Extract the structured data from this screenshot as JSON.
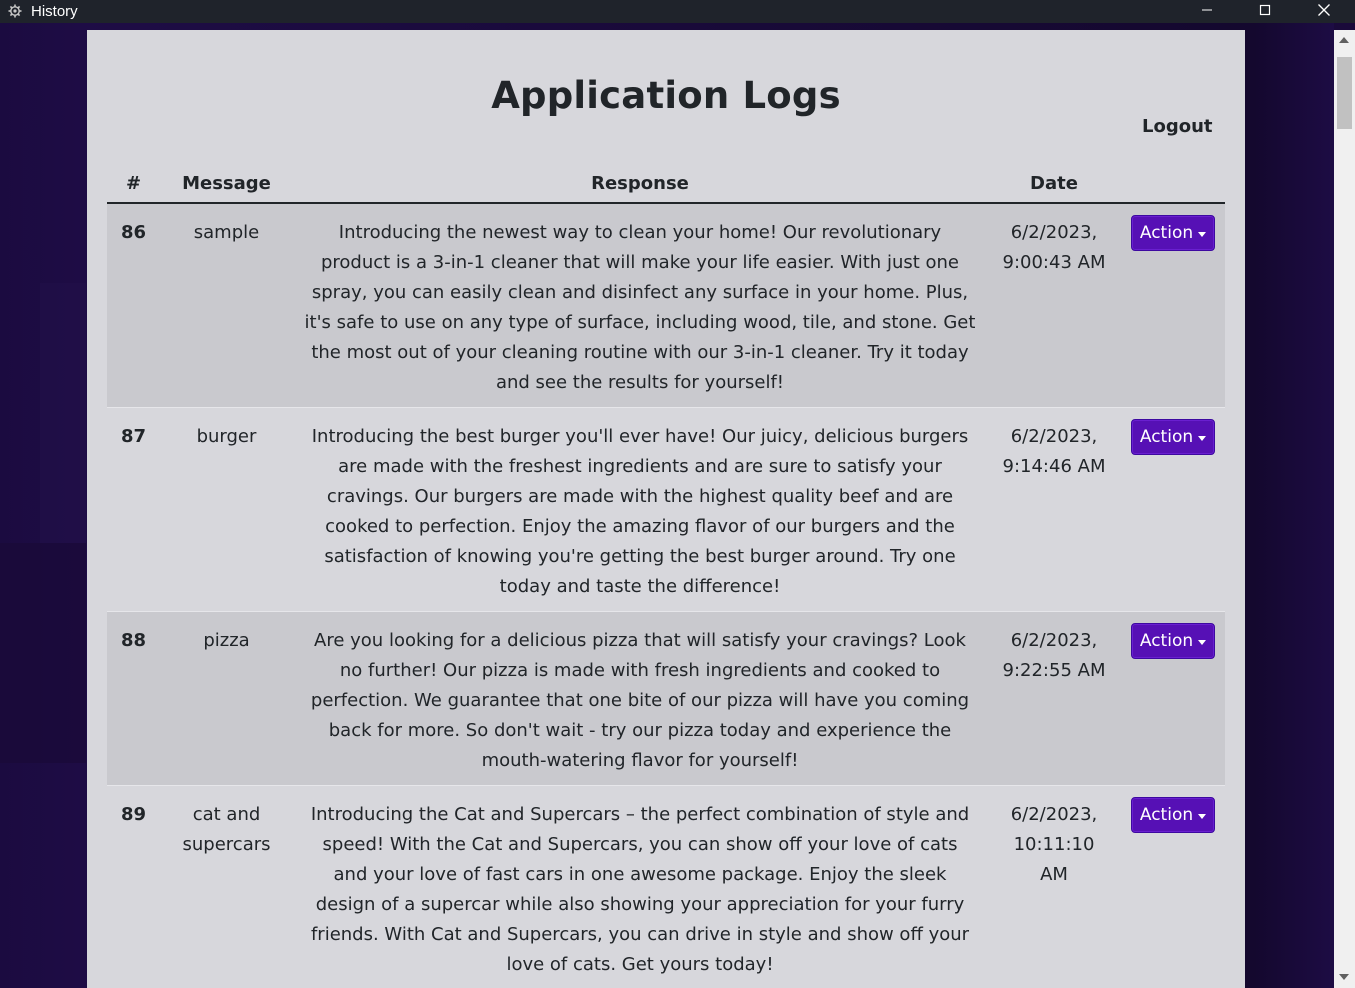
{
  "window": {
    "title": "History",
    "app_icon": "gear-icon",
    "controls": {
      "minimize": "minimize-icon",
      "maximize": "maximize-icon",
      "close": "close-icon"
    }
  },
  "page": {
    "title": "Application Logs",
    "logout_label": "Logout"
  },
  "table": {
    "headers": {
      "num": "#",
      "message": "Message",
      "response": "Response",
      "date": "Date"
    },
    "rows": [
      {
        "id": "86",
        "message": "sample",
        "response": "Introducing the newest way to clean your home! Our revolutionary product is a 3-in-1 cleaner that will make your life easier. With just one spray, you can easily clean and disinfect any surface in your home. Plus, it's safe to use on any type of surface, including wood, tile, and stone. Get the most out of your cleaning routine with our 3-in-1 cleaner. Try it today and see the results for yourself!",
        "date": "6/2/2023, 9:00:43 AM",
        "action_label": "Action"
      },
      {
        "id": "87",
        "message": "burger",
        "response": "Introducing the best burger you'll ever have! Our juicy, delicious burgers are made with the freshest ingredients and are sure to satisfy your cravings. Our burgers are made with the highest quality beef and are cooked to perfection. Enjoy the amazing flavor of our burgers and the satisfaction of knowing you're getting the best burger around. Try one today and taste the difference!",
        "date": "6/2/2023, 9:14:46 AM",
        "action_label": "Action"
      },
      {
        "id": "88",
        "message": "pizza",
        "response": "Are you looking for a delicious pizza that will satisfy your cravings? Look no further! Our pizza is made with fresh ingredients and cooked to perfection. We guarantee that one bite of our pizza will have you coming back for more. So don't wait - try our pizza today and experience the mouth-watering flavor for yourself!",
        "date": "6/2/2023, 9:22:55 AM",
        "action_label": "Action"
      },
      {
        "id": "89",
        "message": "cat and supercars",
        "response": "Introducing the Cat and Supercars – the perfect combination of style and speed! With the Cat and Supercars, you can show off your love of cats and your love of fast cars in one awesome package. Enjoy the sleek design of a supercar while also showing your appreciation for your furry friends. With Cat and Supercars, you can drive in style and show off your love of cats. Get yours today!",
        "date": "6/2/2023, 10:11:10 AM",
        "action_label": "Action"
      }
    ]
  },
  "colors": {
    "accent": "#5610b5",
    "panel": "#d7d7dc",
    "row_stripe": "#c9c9ce",
    "titlebar": "#1f232b"
  }
}
